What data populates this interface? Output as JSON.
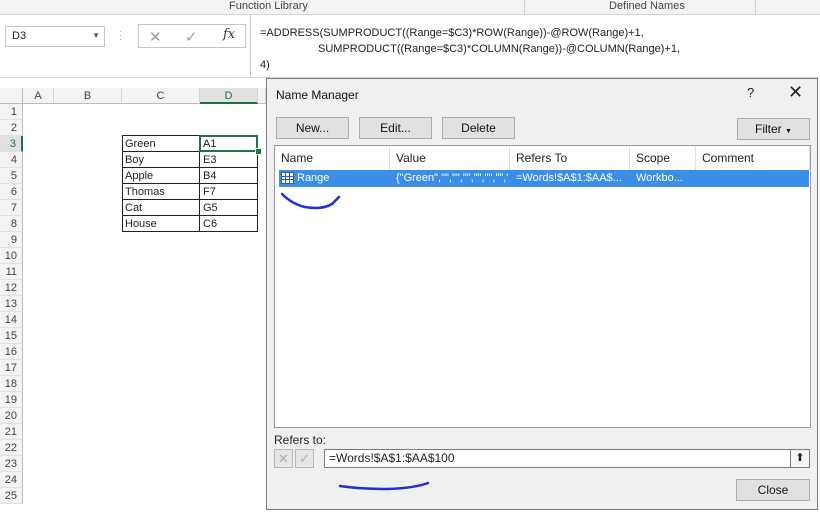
{
  "ribbon": {
    "groups": [
      "Function Library",
      "Defined Names"
    ]
  },
  "formula_bar": {
    "name_box": "D3",
    "fx": "fx",
    "formula_lines": [
      "=ADDRESS(SUMPRODUCT((Range=$C3)*ROW(Range))-@ROW(Range)+1,",
      "SUMPRODUCT((Range=$C3)*COLUMN(Range))-@COLUMN(Range)+1,",
      "4)"
    ]
  },
  "sheet": {
    "columns": [
      "A",
      "B",
      "C",
      "D"
    ],
    "rows": [
      "1",
      "2",
      "3",
      "4",
      "5",
      "6",
      "7",
      "8",
      "9",
      "10",
      "11",
      "12",
      "13",
      "14",
      "15",
      "16",
      "17",
      "18",
      "19",
      "20",
      "21",
      "22",
      "23",
      "24",
      "25"
    ],
    "table": [
      {
        "word": "Green",
        "addr": "A1"
      },
      {
        "word": "Boy",
        "addr": "E3"
      },
      {
        "word": "Apple",
        "addr": "B4"
      },
      {
        "word": "Thomas",
        "addr": "F7"
      },
      {
        "word": "Cat",
        "addr": "G5"
      },
      {
        "word": "House",
        "addr": "C6"
      }
    ],
    "active_cell": "D3"
  },
  "dialog": {
    "title": "Name Manager",
    "help": "?",
    "buttons": {
      "new": "New...",
      "edit": "Edit...",
      "delete": "Delete",
      "filter": "Filter",
      "close": "Close"
    },
    "columns": [
      "Name",
      "Value",
      "Refers To",
      "Scope",
      "Comment"
    ],
    "rows": [
      {
        "name": "Range",
        "value": "{\"Green\",\"\",\"\",\"\",\"\",\"\",\"\",\"...",
        "refers_to": "=Words!$A$1:$AA$...",
        "scope": "Workbo...",
        "comment": ""
      }
    ],
    "refers_to_label": "Refers to:",
    "refers_to_value": "=Words!$A$1:$AA$100"
  },
  "colors": {
    "excel_green": "#217346",
    "selection_blue": "#3a8ee6",
    "ink_blue": "#1f2fd6"
  }
}
